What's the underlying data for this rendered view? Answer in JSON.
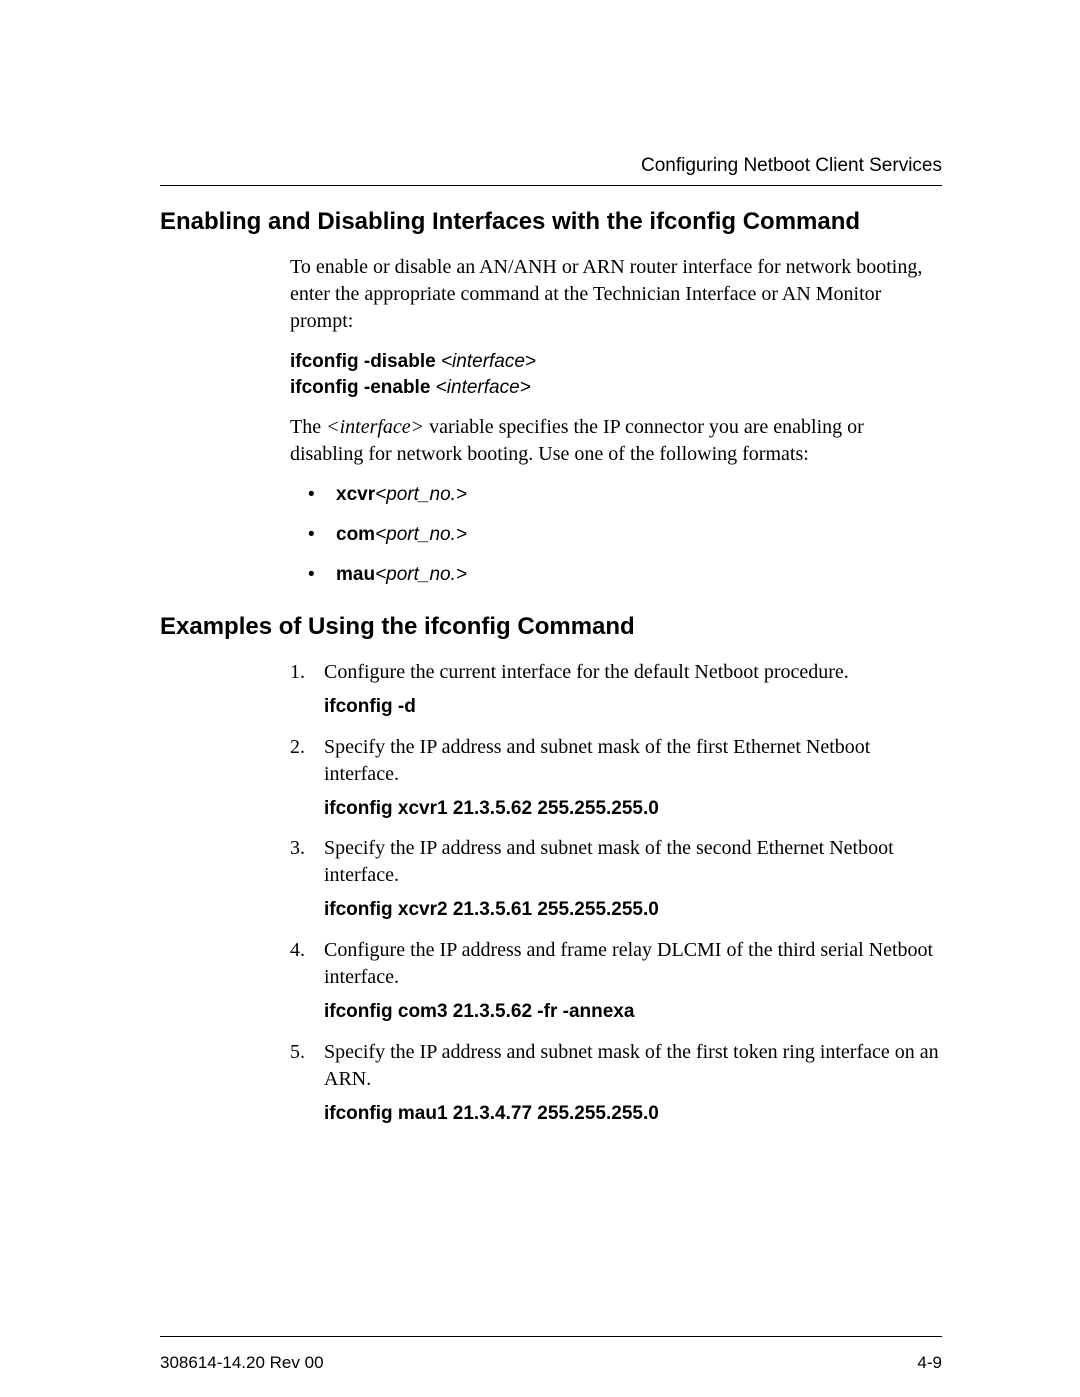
{
  "header": {
    "running_title": "Configuring Netboot Client Services"
  },
  "section1": {
    "title": "Enabling and Disabling Interfaces with the ifconfig Command",
    "intro": "To enable or disable an AN/ANH or ARN router interface for network booting, enter the appropriate command at the Technician Interface or AN Monitor prompt:",
    "cmd1_bold": "ifconfig -disable",
    "cmd1_arg": " <interface>",
    "cmd2_bold": "ifconfig -enable",
    "cmd2_arg": " <interface>",
    "explain_pre": "The ",
    "explain_var": "<interface>",
    "explain_post": " variable specifies the IP connector you are enabling or disabling for network booting. Use one of the following formats:",
    "interfaces": [
      {
        "name": "xcvr",
        "port": "<port_no.>"
      },
      {
        "name": "com",
        "port": "<port_no.>"
      },
      {
        "name": "mau",
        "port": "<port_no.>"
      }
    ]
  },
  "section2": {
    "title": "Examples of Using the ifconfig Command",
    "examples": [
      {
        "text": "Configure the current interface for the default Netboot procedure.",
        "command": "ifconfig -d"
      },
      {
        "text": "Specify the IP address and subnet mask of the first Ethernet Netboot interface.",
        "command": "ifconfig xcvr1 21.3.5.62 255.255.255.0"
      },
      {
        "text": "Specify the IP address and subnet mask of the second Ethernet Netboot interface.",
        "command": "ifconfig xcvr2 21.3.5.61 255.255.255.0"
      },
      {
        "text": "Configure the IP address and frame relay DLCMI of the third serial Netboot interface.",
        "command": "ifconfig com3 21.3.5.62 -fr -annexa"
      },
      {
        "text": "Specify the IP address and subnet mask of the first token ring interface on an ARN.",
        "command": "ifconfig mau1 21.3.4.77 255.255.255.0"
      }
    ]
  },
  "footer": {
    "left": "308614-14.20 Rev 00",
    "right": "4-9"
  }
}
